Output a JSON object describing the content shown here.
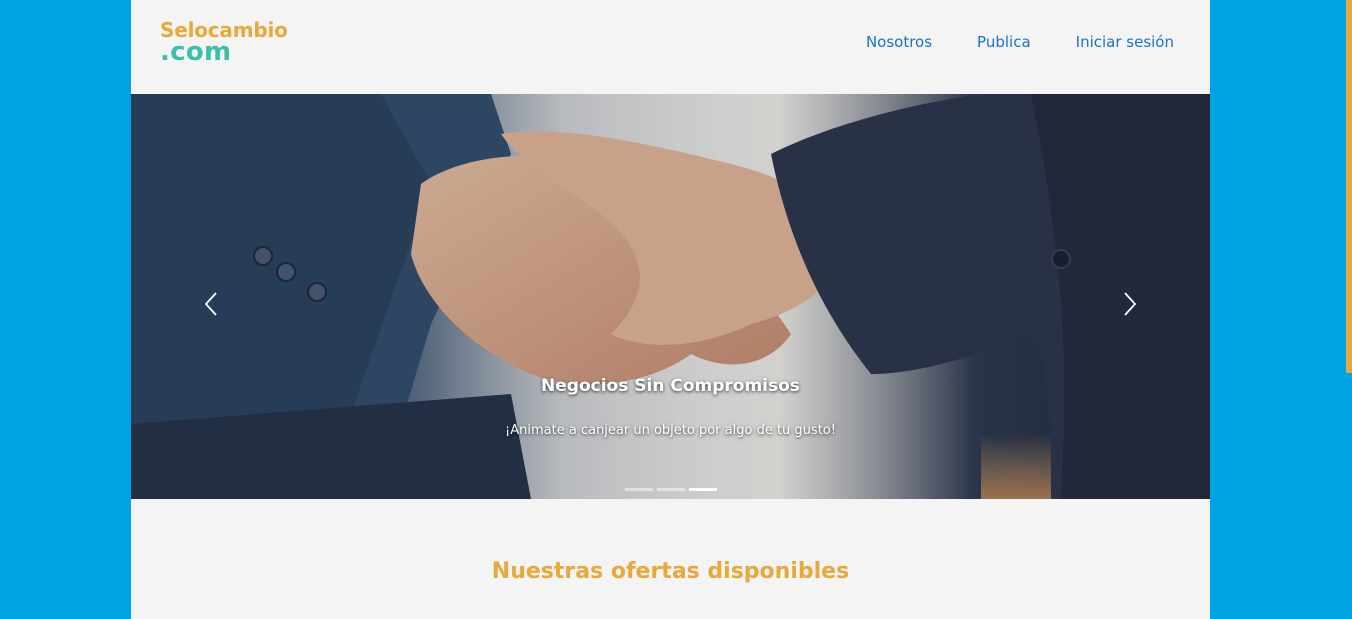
{
  "brand": {
    "name_top": "Selocambio",
    "name_bottom": ".com"
  },
  "nav": {
    "items": [
      "Nosotros",
      "Publica",
      "Iniciar sesión"
    ]
  },
  "carousel": {
    "caption_title": "Negocios Sin Compromisos",
    "caption_text": "¡Animate a canjear un objeto por algo de tu gusto!",
    "slide_count": 3,
    "active_index": 2
  },
  "sections": {
    "offers_title": "Nuestras ofertas disponibles"
  },
  "colors": {
    "background": "#00a3e4",
    "page": "#f4f4f4",
    "accent": "#e8a93a",
    "logo_secondary": "#3bbfa9",
    "link": "#1a73c9"
  }
}
